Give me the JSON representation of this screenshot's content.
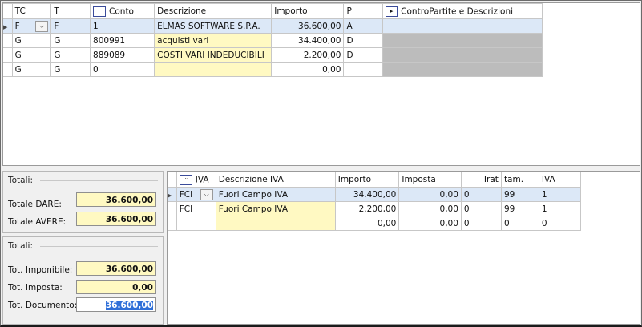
{
  "top_grid": {
    "headers": {
      "tc": "TC",
      "t": "T",
      "conto": "Conto",
      "descrizione": "Descrizione",
      "importo": "Importo",
      "p": "P",
      "contropartite": "ControPartite e Descrizioni"
    },
    "rows": [
      {
        "tc": "F",
        "t": "F",
        "conto": "1",
        "descrizione": "ELMAS SOFTWARE S.P.A.",
        "importo": "36.600,00",
        "p": "A"
      },
      {
        "tc": "G",
        "t": "G",
        "conto": "800991",
        "descrizione": "acquisti vari",
        "importo": "34.400,00",
        "p": "D"
      },
      {
        "tc": "G",
        "t": "G",
        "conto": "889089",
        "descrizione": "COSTI VARI INDEDUCIBILI",
        "importo": "2.200,00",
        "p": "D"
      },
      {
        "tc": "G",
        "t": "G",
        "conto": "0",
        "descrizione": "",
        "importo": "0,00",
        "p": ""
      }
    ]
  },
  "totali_group": {
    "title": "Totali:",
    "dare_label": "Totale DARE:",
    "dare_value": "36.600,00",
    "avere_label": "Totale AVERE:",
    "avere_value": "36.600,00"
  },
  "totali_group2": {
    "title": "Totali:",
    "imponibile_label": "Tot. Imponibile:",
    "imponibile_value": "36.600,00",
    "imposta_label": "Tot. Imposta:",
    "imposta_value": "0,00",
    "documento_label": "Tot. Documento:",
    "documento_value": "36.600,00"
  },
  "iva_grid": {
    "headers": {
      "iva": "IVA",
      "descrizione": "Descrizione IVA",
      "importo": "Importo",
      "imposta": "Imposta",
      "trat": "Trat",
      "tam": "tam.",
      "iva2": "IVA"
    },
    "rows": [
      {
        "iva": "FCI",
        "descrizione": "Fuori Campo IVA",
        "importo": "34.400,00",
        "imposta": "0,00",
        "trat": "0",
        "tam": "99",
        "iva2": "1"
      },
      {
        "iva": "FCI",
        "descrizione": "Fuori Campo IVA",
        "importo": "2.200,00",
        "imposta": "0,00",
        "trat": "0",
        "tam": "99",
        "iva2": "1"
      },
      {
        "iva": "",
        "descrizione": "",
        "importo": "0,00",
        "imposta": "0,00",
        "trat": "0",
        "tam": "0",
        "iva2": "0"
      }
    ]
  }
}
